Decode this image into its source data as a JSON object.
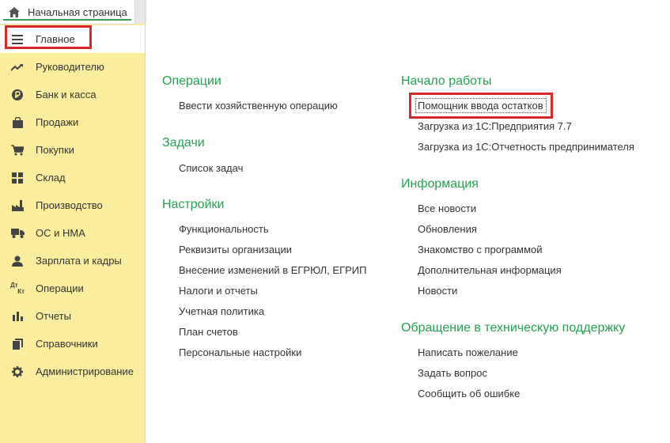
{
  "home_tab": {
    "label": "Начальная страница"
  },
  "sidebar": {
    "items": [
      {
        "label": "Главное",
        "icon": "menu-icon"
      },
      {
        "label": "Руководителю",
        "icon": "trend-icon"
      },
      {
        "label": "Банк и касса",
        "icon": "ruble-icon"
      },
      {
        "label": "Продажи",
        "icon": "bag-icon"
      },
      {
        "label": "Покупки",
        "icon": "cart-icon"
      },
      {
        "label": "Склад",
        "icon": "warehouse-icon"
      },
      {
        "label": "Производство",
        "icon": "factory-icon"
      },
      {
        "label": "ОС и НМА",
        "icon": "truck-icon"
      },
      {
        "label": "Зарплата и кадры",
        "icon": "person-icon"
      },
      {
        "label": "Операции",
        "icon": "debit-credit-icon",
        "glyph_top": "Дт",
        "glyph_bottom": "Кт"
      },
      {
        "label": "Отчеты",
        "icon": "bar-chart-icon"
      },
      {
        "label": "Справочники",
        "icon": "books-icon"
      },
      {
        "label": "Администрирование",
        "icon": "gear-icon"
      }
    ]
  },
  "content": {
    "operations": {
      "title": "Операции",
      "links": [
        "Ввести хозяйственную операцию"
      ]
    },
    "tasks": {
      "title": "Задачи",
      "links": [
        "Список задач"
      ]
    },
    "settings": {
      "title": "Настройки",
      "links": [
        "Функциональность",
        "Реквизиты организации",
        "Внесение изменений в ЕГРЮЛ, ЕГРИП",
        "Налоги и отчеты",
        "Учетная политика",
        "План счетов",
        "Персональные настройки"
      ]
    },
    "start": {
      "title": "Начало работы",
      "links": [
        "Помощник ввода остатков",
        "Загрузка из 1С:Предприятия 7.7",
        "Загрузка из 1С:Отчетность предпринимателя"
      ]
    },
    "info": {
      "title": "Информация",
      "links": [
        "Все новости",
        "Обновления",
        "Знакомство с программой",
        "Дополнительная информация",
        "Новости"
      ]
    },
    "support": {
      "title": "Обращение в техническую поддержку",
      "links": [
        "Написать пожелание",
        "Задать вопрос",
        "Сообщить об ошибке"
      ]
    }
  },
  "colors": {
    "sidebar_bg": "#fbed9e",
    "section_title": "#22a150",
    "highlight": "#d52b2b"
  }
}
